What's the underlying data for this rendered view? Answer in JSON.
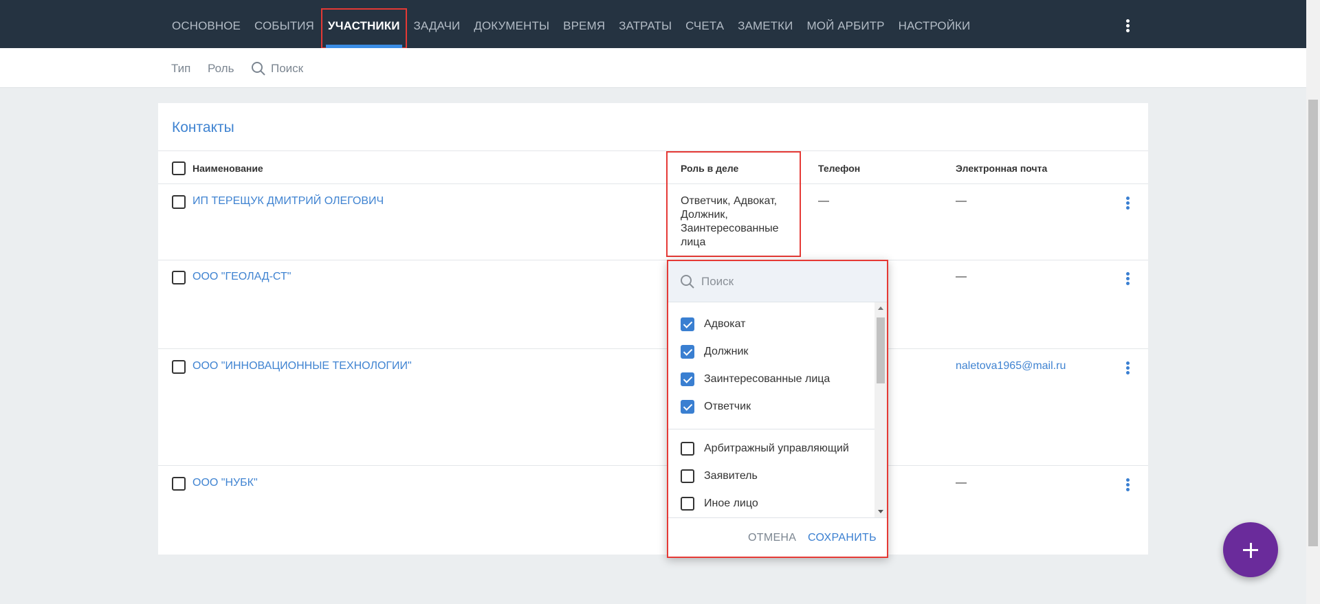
{
  "nav": {
    "items": [
      {
        "label": "ОСНОВНОЕ"
      },
      {
        "label": "СОБЫТИЯ"
      },
      {
        "label": "УЧАСТНИКИ",
        "active": true
      },
      {
        "label": "ЗАДАЧИ"
      },
      {
        "label": "ДОКУМЕНТЫ"
      },
      {
        "label": "ВРЕМЯ"
      },
      {
        "label": "ЗАТРАТЫ"
      },
      {
        "label": "СЧЕТА"
      },
      {
        "label": "ЗАМЕТКИ"
      },
      {
        "label": "МОЙ АРБИТР"
      },
      {
        "label": "НАСТРОЙКИ"
      }
    ],
    "menu_icon": "more-vertical-icon"
  },
  "filters": {
    "type": "Тип",
    "role": "Роль",
    "search": "Поиск"
  },
  "contacts": {
    "title": "Контакты",
    "headers": {
      "name": "Наименование",
      "role": "Роль в деле",
      "phone": "Телефон",
      "email": "Электронная почта"
    },
    "rows": [
      {
        "name": "ИП ТЕРЕЩУК ДМИТРИЙ ОЛЕГОВИЧ",
        "role": "Ответчик, Адвокат, Должник, Заинтересованные лица",
        "phone": "—",
        "email": "—"
      },
      {
        "name": "ООО \"ГЕОЛАД-СТ\"",
        "email": "—"
      },
      {
        "name": "ООО \"ИННОВАЦИОННЫЕ ТЕХНОЛОГИИ\"",
        "email": "naletova1965@mail.ru"
      },
      {
        "name": "ООО \"НУБК\"",
        "email": "—"
      }
    ]
  },
  "role_dropdown": {
    "search_placeholder": "Поиск",
    "checked": [
      "Адвокат",
      "Должник",
      "Заинтересованные лица",
      "Ответчик"
    ],
    "unchecked": [
      "Арбитражный управляющий",
      "Заявитель",
      "Иное лицо"
    ],
    "cancel": "ОТМЕНА",
    "save": "СОХРАНИТЬ"
  },
  "colors": {
    "nav_bg": "#253341",
    "accent": "#3a7fd1",
    "highlight": "#e53935",
    "fab": "#6a2b9b"
  }
}
